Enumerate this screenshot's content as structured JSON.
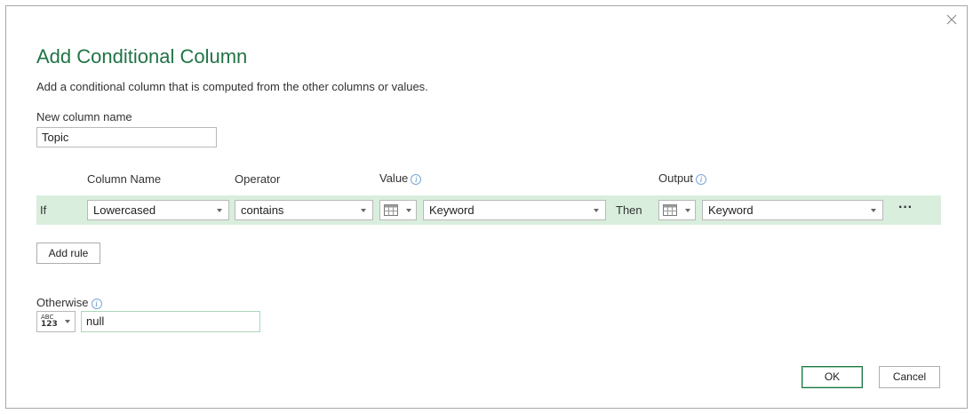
{
  "dialog": {
    "title": "Add Conditional Column",
    "subtitle": "Add a conditional column that is computed from the other columns or values."
  },
  "new_column": {
    "label": "New column name",
    "value": "Topic"
  },
  "headers": {
    "column_name": "Column Name",
    "operator": "Operator",
    "value": "Value",
    "output": "Output"
  },
  "rule": {
    "if_label": "If",
    "column_name": "Lowercased",
    "operator": "contains",
    "value": "Keyword",
    "then_label": "Then",
    "output": "Keyword",
    "more": "···"
  },
  "buttons": {
    "add_rule": "Add rule",
    "ok": "OK",
    "cancel": "Cancel"
  },
  "otherwise": {
    "label": "Otherwise",
    "type_text_top": "ABC",
    "type_text_bottom": "123",
    "value": "null"
  },
  "icons": {
    "close": "close-icon",
    "info": "info-icon",
    "table": "table-icon"
  },
  "colors": {
    "accent": "#217346",
    "rule_band": "#d9eedd"
  }
}
